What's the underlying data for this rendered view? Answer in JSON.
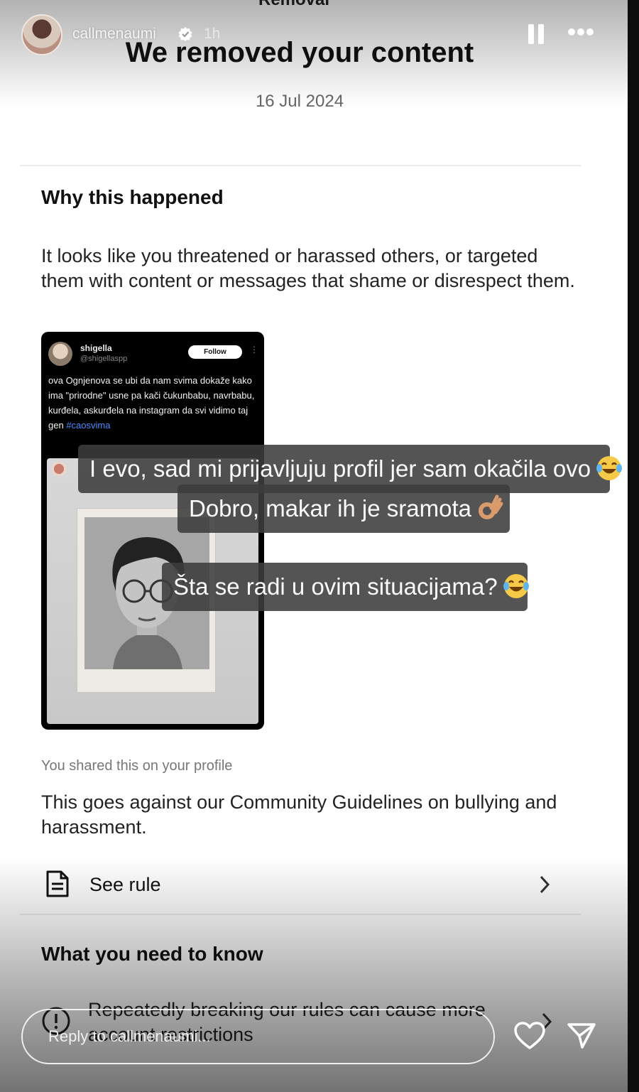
{
  "story": {
    "username": "callmenaumi",
    "time_ago": "1h",
    "reply_placeholder": "Reply to callmenaumi..."
  },
  "removal": {
    "screen_title": "Removal",
    "title": "We removed your content",
    "date": "16 Jul 2024",
    "why_heading": "Why this happened",
    "why_text": "It looks like you threatened or harassed others, or targeted them with content or messages that shame or disrespect them.",
    "shared_note": "You shared this on your profile",
    "guideline_text": "This goes against our Community Guidelines on bullying and harassment.",
    "see_rule_label": "See rule",
    "know_heading": "What you need to know",
    "know_text": "Repeatedly breaking our rules can cause more account restrictions"
  },
  "post": {
    "name": "shigella",
    "handle": "@shigellaspp",
    "follow_label": "Follow",
    "text": "ova Ognjenova se ubi da nam svima dokaže kako ima \"prirodne\" usne pa kači čukunbabu, navrbabu, kurđela, askurđela na instagram da svi vidimo taj gen",
    "hashtag": "#caosvima"
  },
  "stickers": {
    "line1": "I evo, sad mi prijavljuju profil jer sam okačila ovo",
    "line2": "Dobro, makar ih je sramota",
    "line3": "Šta se radi u ovim situacijama?"
  },
  "icons": {
    "verified": "verified-badge-icon",
    "pause": "pause-icon",
    "more": "more-icon",
    "document": "document-icon",
    "chevron": "chevron-right-icon",
    "warning": "warning-icon",
    "heart": "heart-icon",
    "send": "send-icon",
    "laugh_emoji": "laughing-tears-emoji",
    "ok_emoji": "ok-hand-emoji"
  },
  "colors": {
    "background": "#ffffff",
    "hashtag": "#4a8cff",
    "sticker_bg": "#3c3c3c"
  }
}
